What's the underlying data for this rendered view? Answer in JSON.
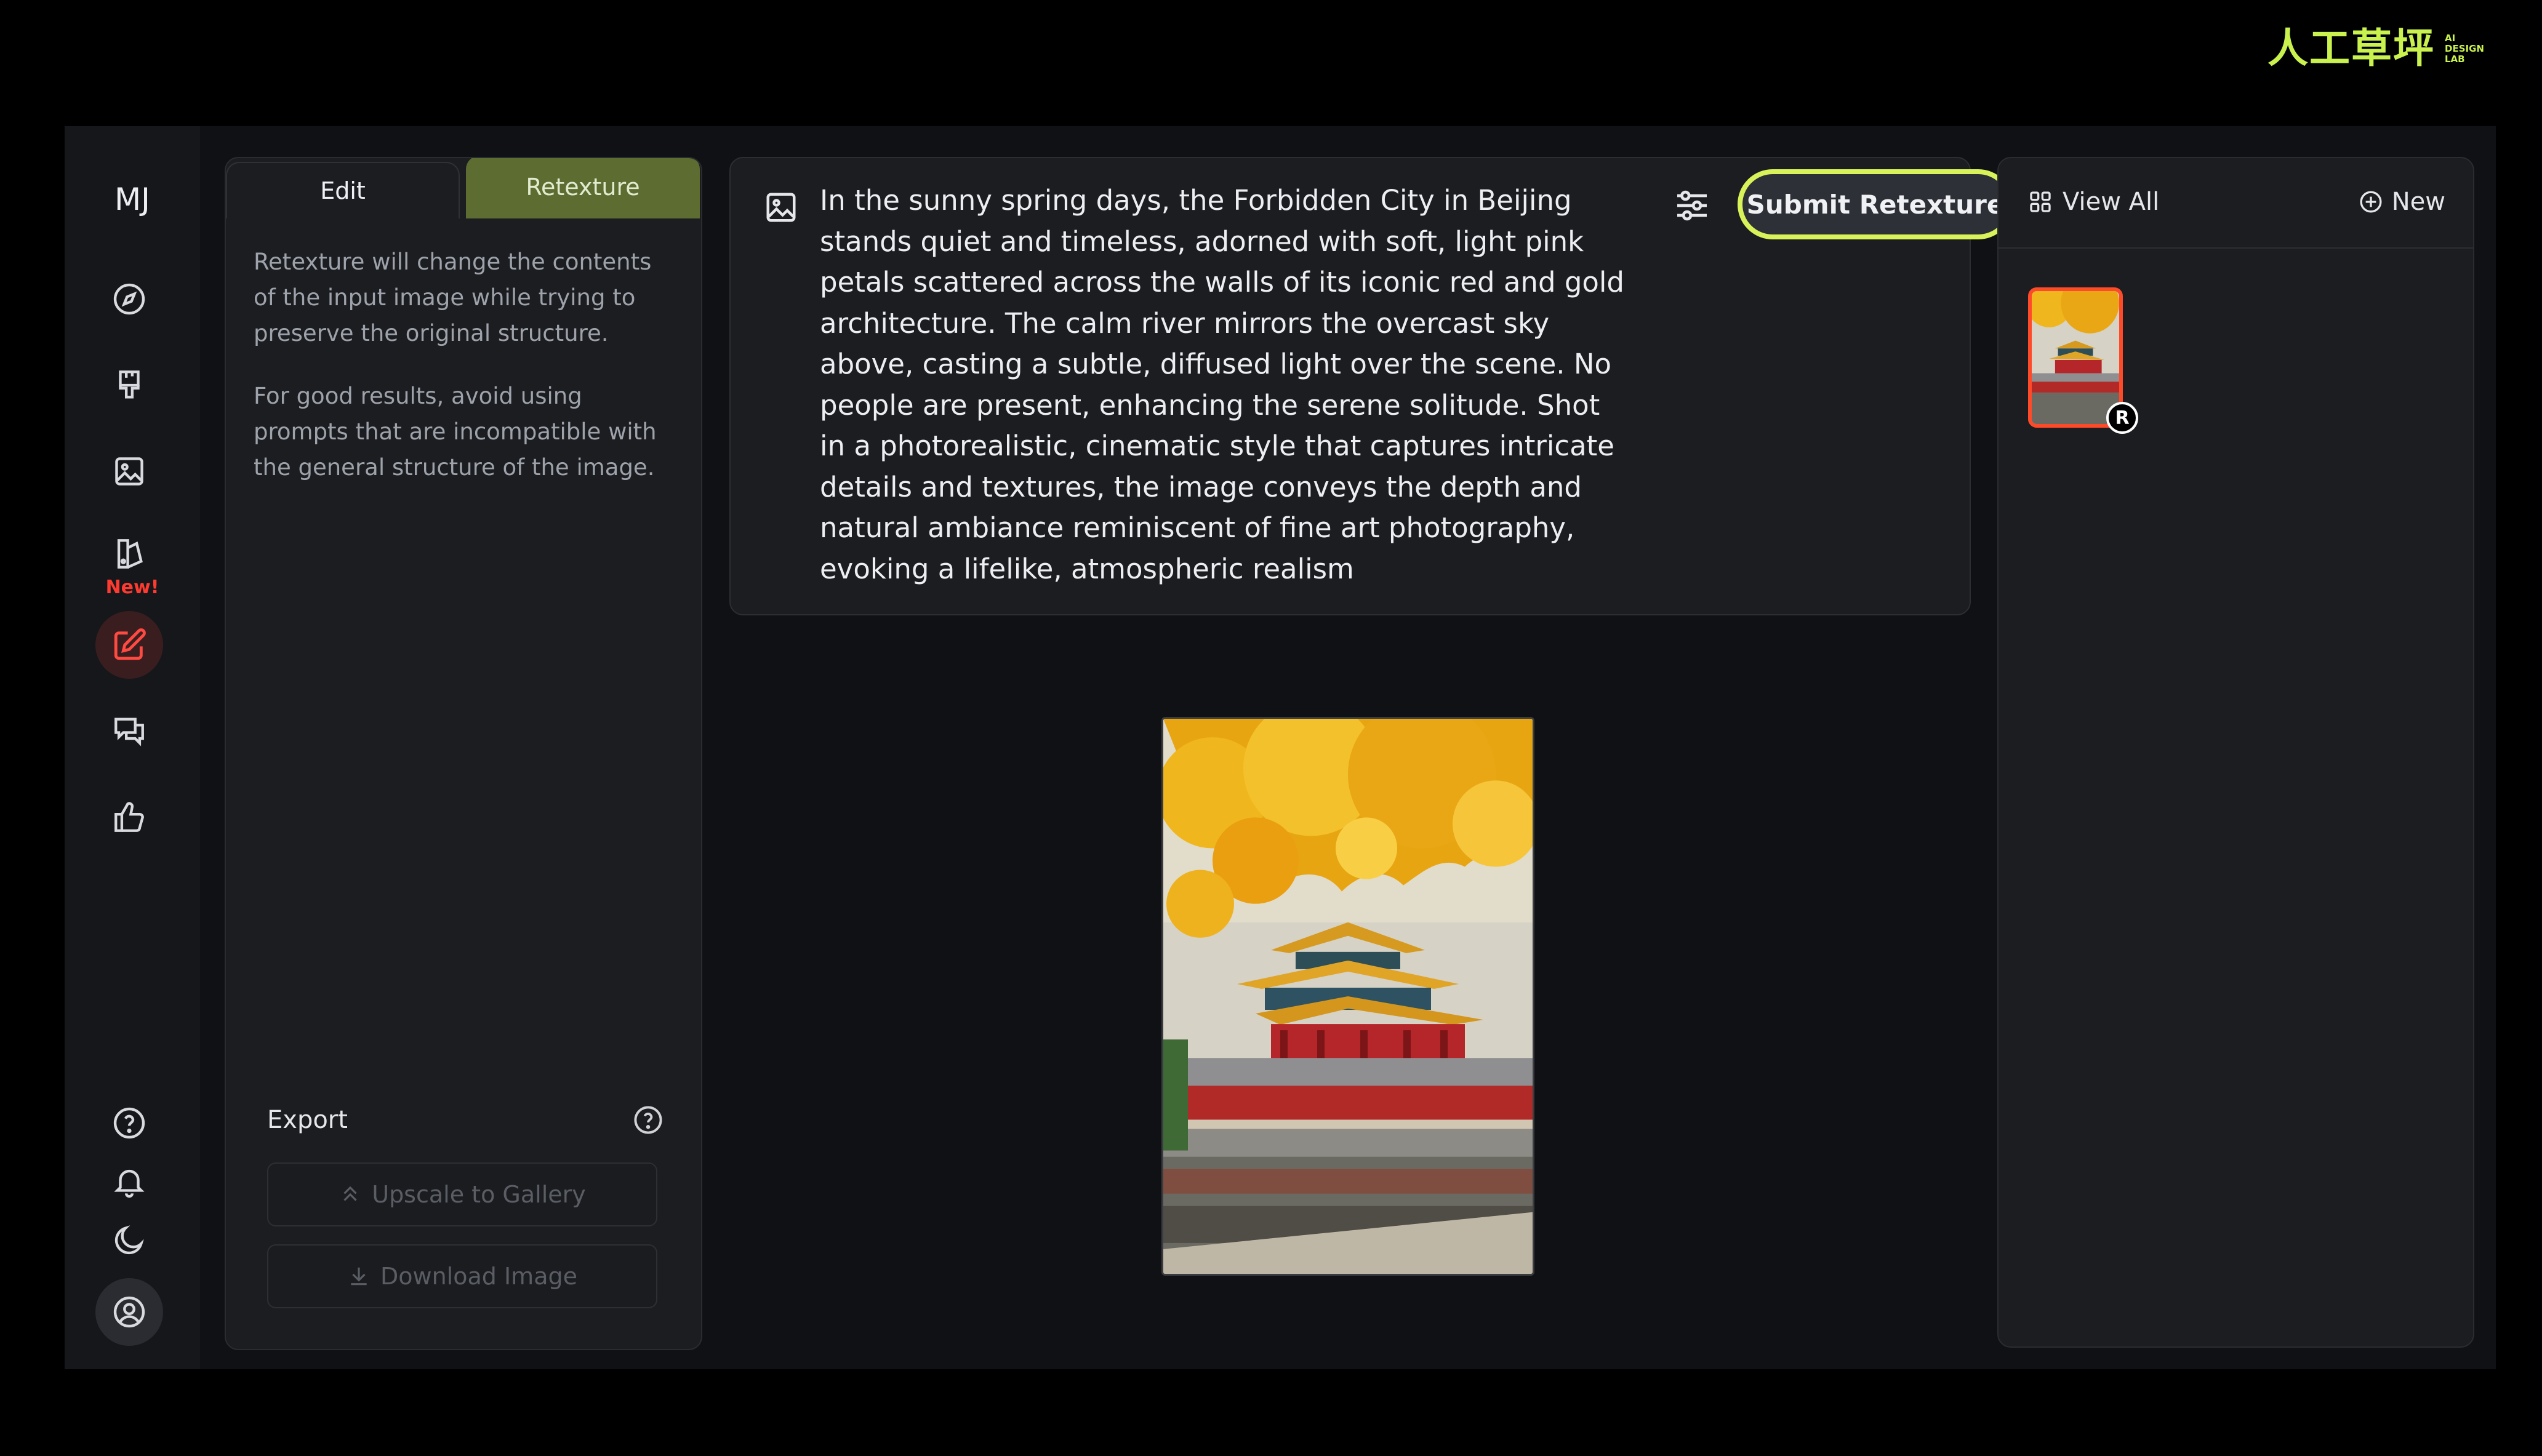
{
  "brand": {
    "cn": "人工草坪",
    "en_line1": "AI",
    "en_line2": "DESIGN",
    "en_line3": "LAB"
  },
  "rail": {
    "logo": "MJ",
    "new_badge": "New!",
    "icons": [
      "explore-icon",
      "paint-brush-icon",
      "image-icon",
      "editor-icon",
      "edit-icon",
      "chat-icon",
      "thumbs-up-icon",
      "help-icon",
      "bell-icon",
      "moon-icon",
      "user-icon"
    ]
  },
  "panel": {
    "tab_edit": "Edit",
    "tab_retexture": "Retexture",
    "para1": "Retexture will change the contents of the input image while trying to preserve the original structure.",
    "para2": "For good results, avoid using prompts that are incompatible with the general structure of the image.",
    "export_label": "Export",
    "upscale_label": "Upscale to Gallery",
    "download_label": "Download Image"
  },
  "prompt": {
    "text": "In the sunny spring days, the Forbidden City in Beijing stands quiet and timeless, adorned with soft, light pink petals scattered across the walls of its iconic red and gold architecture. The calm river mirrors the overcast sky above, casting a subtle, diffused light over the scene. No people are present, enhancing the serene solitude. Shot in a photorealistic, cinematic style that captures intricate details and textures, the image conveys the depth and natural ambiance reminiscent of fine art photography, evoking a lifelike, atmospheric realism",
    "submit_label": "Submit Retexture"
  },
  "right": {
    "view_all": "View All",
    "new": "New",
    "thumb_badge": "R"
  },
  "colors": {
    "accent_highlight": "#d8f25a",
    "retexture_tab": "#5d6d32",
    "active_red": "#ff4a42",
    "thumb_border": "#ff4a2a"
  }
}
